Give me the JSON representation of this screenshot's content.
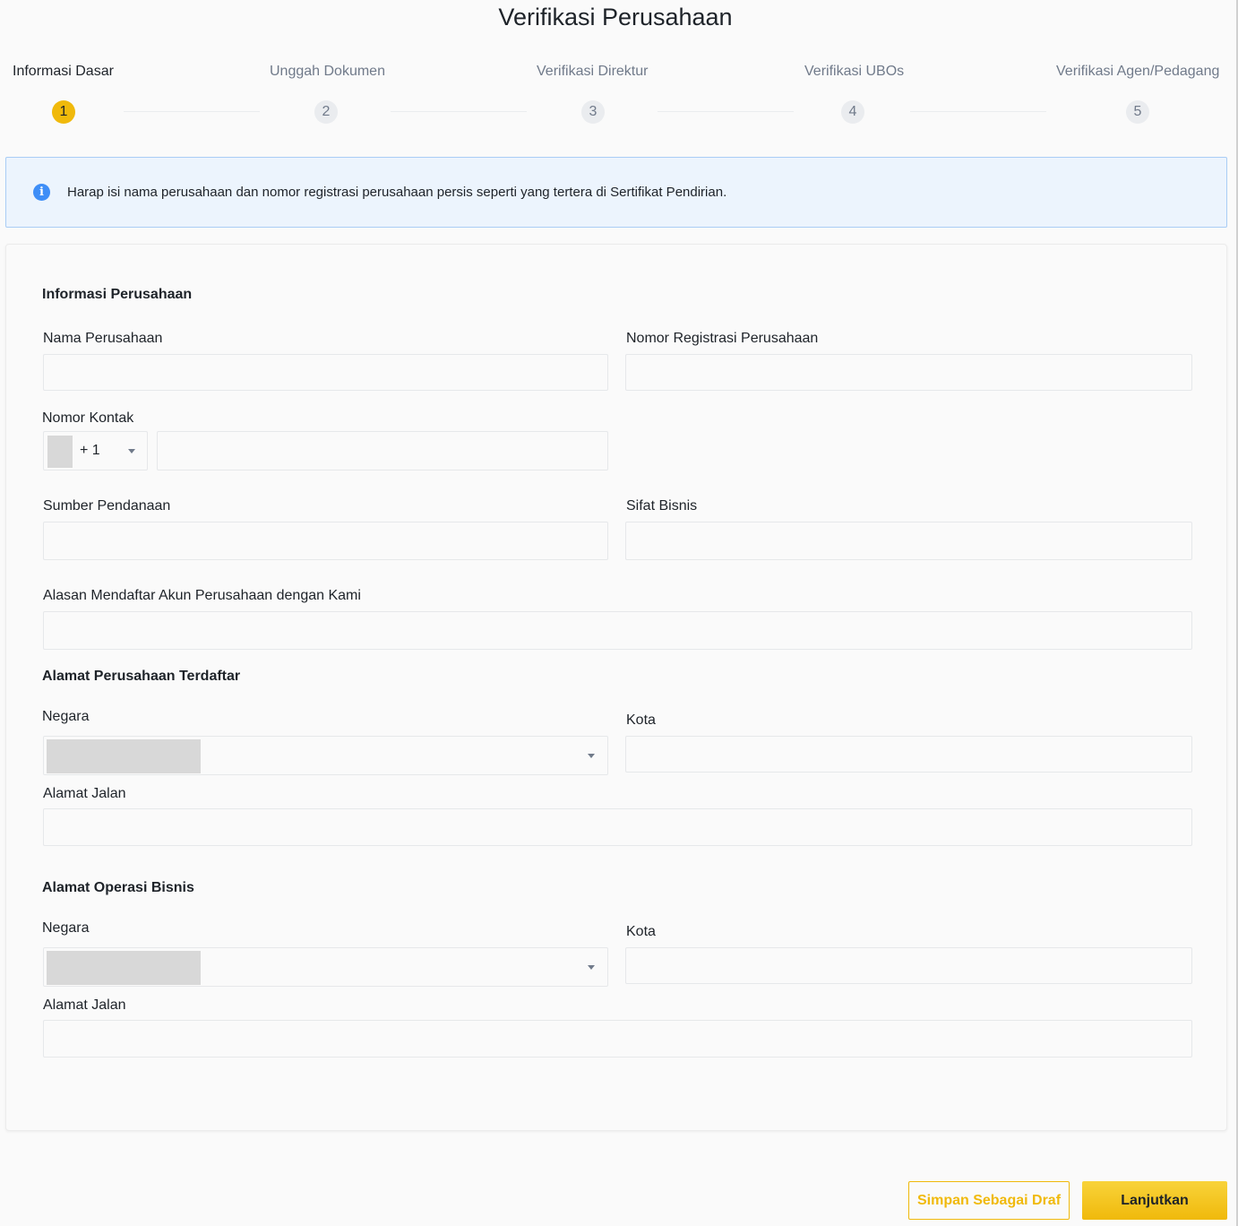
{
  "page": {
    "title": "Verifikasi Perusahaan"
  },
  "steps": [
    {
      "number": "1",
      "label": "Informasi Dasar",
      "active": true
    },
    {
      "number": "2",
      "label": "Unggah Dokumen",
      "active": false
    },
    {
      "number": "3",
      "label": "Verifikasi Direktur",
      "active": false
    },
    {
      "number": "4",
      "label": "Verifikasi UBOs",
      "active": false
    },
    {
      "number": "5",
      "label": "Verifikasi Agen/Pedagang",
      "active": false
    }
  ],
  "info_banner": {
    "icon": "info-icon",
    "text": "Harap isi nama perusahaan dan nomor registrasi perusahaan persis seperti yang tertera di Sertifikat Pendirian."
  },
  "company_info": {
    "title": "Informasi Perusahaan",
    "company_name_label": "Nama Perusahaan",
    "company_name_value": "",
    "registration_number_label": "Nomor Registrasi Perusahaan",
    "registration_number_value": "",
    "contact_number_label": "Nomor Kontak",
    "country_code": "+ 1",
    "contact_number_value": "",
    "source_of_funds_label": "Sumber Pendanaan",
    "source_of_funds_value": "",
    "business_nature_label": "Sifat Bisnis",
    "business_nature_value": "",
    "reason_label": "Alasan Mendaftar Akun Perusahaan dengan Kami",
    "reason_value": ""
  },
  "registered_address": {
    "title": "Alamat Perusahaan Terdaftar",
    "country_label": "Negara",
    "city_label": "Kota",
    "city_value": "",
    "street_label": "Alamat Jalan",
    "street_value": ""
  },
  "operating_address": {
    "title": "Alamat Operasi Bisnis",
    "country_label": "Negara",
    "city_label": "Kota",
    "city_value": "",
    "street_label": "Alamat Jalan",
    "street_value": ""
  },
  "actions": {
    "save_draft_label": "Simpan Sebagai Draf",
    "continue_label": "Lanjutkan"
  },
  "colors": {
    "accent": "#f0b90b",
    "info_bg": "#ecf4fd",
    "info_border": "#a9cdf5",
    "info_icon": "#3e8ef7"
  }
}
